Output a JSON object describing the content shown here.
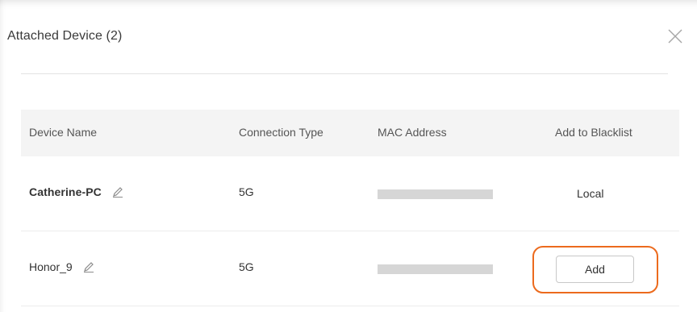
{
  "dialog": {
    "title": "Attached Device (2)",
    "close_icon": "close-icon"
  },
  "table": {
    "headers": {
      "device_name": "Device Name",
      "connection_type": "Connection Type",
      "mac_address": "MAC Address",
      "add_to_blacklist": "Add to Blacklist"
    },
    "rows": [
      {
        "device_name": "Catherine-PC",
        "connection_type": "5G",
        "mac_address_redacted": true,
        "blacklist": "Local",
        "edit_icon": "pencil-icon"
      },
      {
        "device_name": "Honor_9",
        "connection_type": "5G",
        "mac_address_redacted": true,
        "blacklist": "Add",
        "edit_icon": "pencil-icon"
      }
    ]
  },
  "colors": {
    "highlight_outline": "#ec6a1d",
    "header_background": "#f4f4f4",
    "redaction_bar": "#d6d6d6"
  }
}
